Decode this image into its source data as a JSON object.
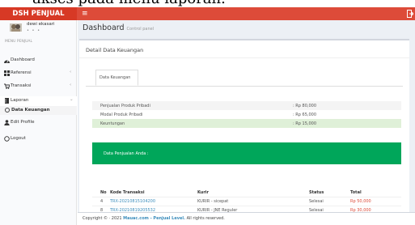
{
  "top_strip_text": "akses pada menu laporan.",
  "app": {
    "logo": "DSH PENJUAL",
    "menu_toggle_icon": "hamburger-icon",
    "logout_icon": "logout-icon"
  },
  "user": {
    "name": "dewi ekasari",
    "status": "• • •"
  },
  "sidebar": {
    "menu_header": "MENU PENJUAL",
    "items": [
      {
        "label": "Dashboard",
        "icon": "dashboard-icon"
      },
      {
        "label": "Referensi",
        "icon": "grid-icon",
        "caret": "‹"
      },
      {
        "label": "Transaksi",
        "icon": "cart-icon",
        "caret": "‹"
      },
      {
        "label": "Laporan",
        "icon": "book-icon",
        "caret": "⌄"
      },
      {
        "label": "Data Keuangan",
        "icon": "circle-icon"
      },
      {
        "label": "Edit Profile",
        "icon": "user-icon"
      },
      {
        "label": "Logout",
        "icon": "circle-icon"
      }
    ]
  },
  "page": {
    "title": "Dashboard",
    "subtitle": "Control panel"
  },
  "box": {
    "title": "Detail Data Keuangan",
    "tab_label": "Data Keuangan"
  },
  "summary": [
    {
      "label": "Penjualan Produk Pribadi",
      "value": ": Rp 80,000"
    },
    {
      "label": "Modal Produk Pribadi",
      "value": ": Rp 65,000"
    },
    {
      "label": "Keuntungan",
      "value": ": Rp 15,000"
    }
  ],
  "callout": "Data Penjualan Anda :",
  "table": {
    "headers": [
      "No",
      "Kode Transaksi",
      "Kurir",
      "Status",
      "Total"
    ],
    "rows": [
      {
        "no": "4",
        "kode": "TRX-20210815104200",
        "kurir": "KURIR - sicepat",
        "status": "Selesai",
        "total": "Rp 50,000"
      },
      {
        "no": "8",
        "kode": "TRX-20210819205532",
        "kurir": "KURIR - JNE Reguler",
        "status": "Selesai",
        "total": "Rp 30,000"
      }
    ]
  },
  "footer": {
    "prefix": "Copyright © · 2021",
    "brand": "Mauac.com - Penjual Level.",
    "suffix": "All rights reserved."
  },
  "colors": {
    "header": "#dd4b39",
    "logo_bg": "#d73925",
    "success": "#00a65a",
    "link": "#3c8dbc",
    "content_bg": "#ecf0f5"
  }
}
